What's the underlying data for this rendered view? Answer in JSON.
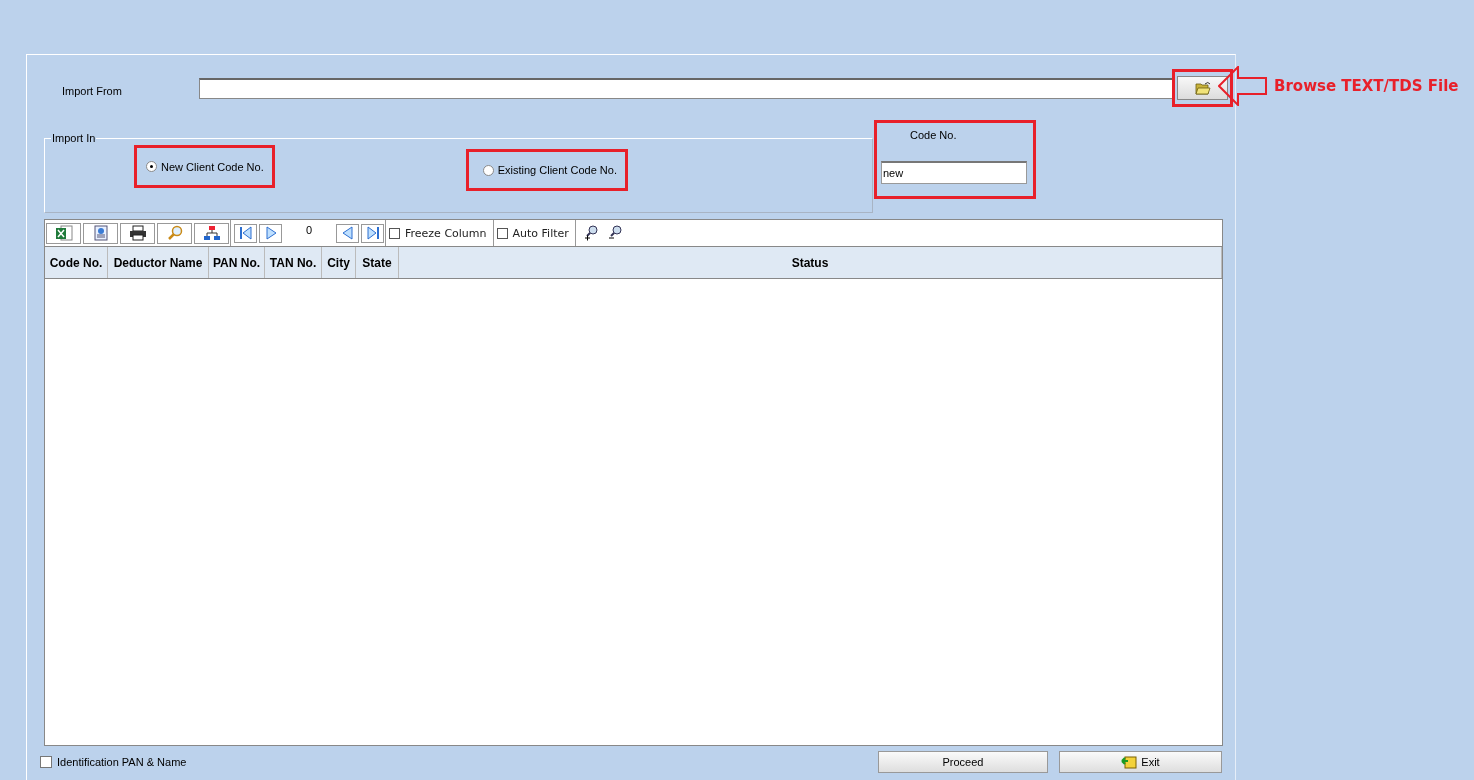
{
  "import_from": {
    "label": "Import From"
  },
  "import_in": {
    "legend": "Import In",
    "options": [
      {
        "label": "New Client Code No.",
        "selected": true
      },
      {
        "label": "Existing Client Code No.",
        "selected": false
      }
    ]
  },
  "code_no": {
    "label": "Code No.",
    "value": "new"
  },
  "toolbar": {
    "counter": "0",
    "checkboxes": [
      {
        "label": "Freeze Column",
        "checked": false
      },
      {
        "label": "Auto Filter",
        "checked": false
      }
    ]
  },
  "table": {
    "columns": [
      "Code No.",
      "Deductor Name",
      "PAN No.",
      "TAN No.",
      "City",
      "State",
      "Status"
    ]
  },
  "identification": {
    "label": "Identification PAN & Name",
    "checked": false
  },
  "buttons": [
    {
      "label": "Proceed",
      "kind": "plain"
    },
    {
      "label": "Exit",
      "kind": "exit"
    }
  ],
  "annotation": {
    "text": "Browse TEXT/TDS File"
  }
}
